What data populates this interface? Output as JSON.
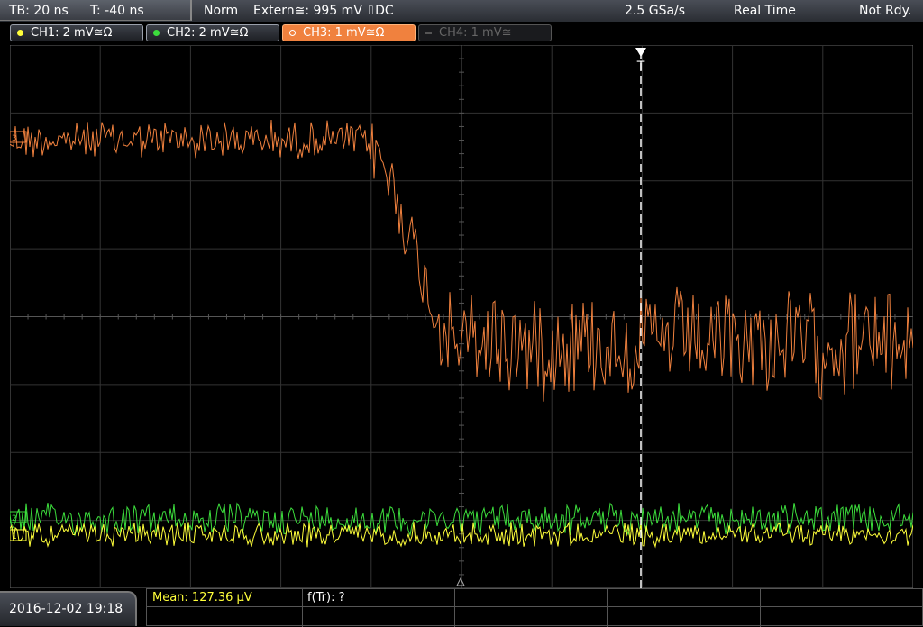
{
  "status_bar": {
    "timebase": "TB: 20 ns",
    "trigger_time": "T: -40 ns",
    "mode": "Norm",
    "trigger_source": "Extern≅: 995 mV ⎍DC",
    "sample_rate": "2.5 GSa/s",
    "acquisition": "Real Time",
    "status": "Not Rdy."
  },
  "channels": [
    {
      "label": "CH1: 2 mV≅Ω",
      "color": "#ffff3a",
      "state": "on"
    },
    {
      "label": "CH2: 2 mV≅Ω",
      "color": "#3cdd3c",
      "state": "on"
    },
    {
      "label": "CH3: 1 mV≅Ω",
      "color": "#f0813e",
      "state": "active"
    },
    {
      "label": "CH4: 1 mV≅",
      "color": "#666666",
      "state": "off"
    }
  ],
  "traces": {
    "ch3_color": "#f0813e",
    "ch2_color": "#3cdd3c",
    "ch1_color": "#ffff3a",
    "trigger_color": "#ffffff"
  },
  "trigger_marker": "T",
  "bottom": {
    "datetime": "2016-12-02 19:18",
    "mean_label": "Mean: 127.36 µV",
    "ftr_label": "f(Tr): ?"
  }
}
